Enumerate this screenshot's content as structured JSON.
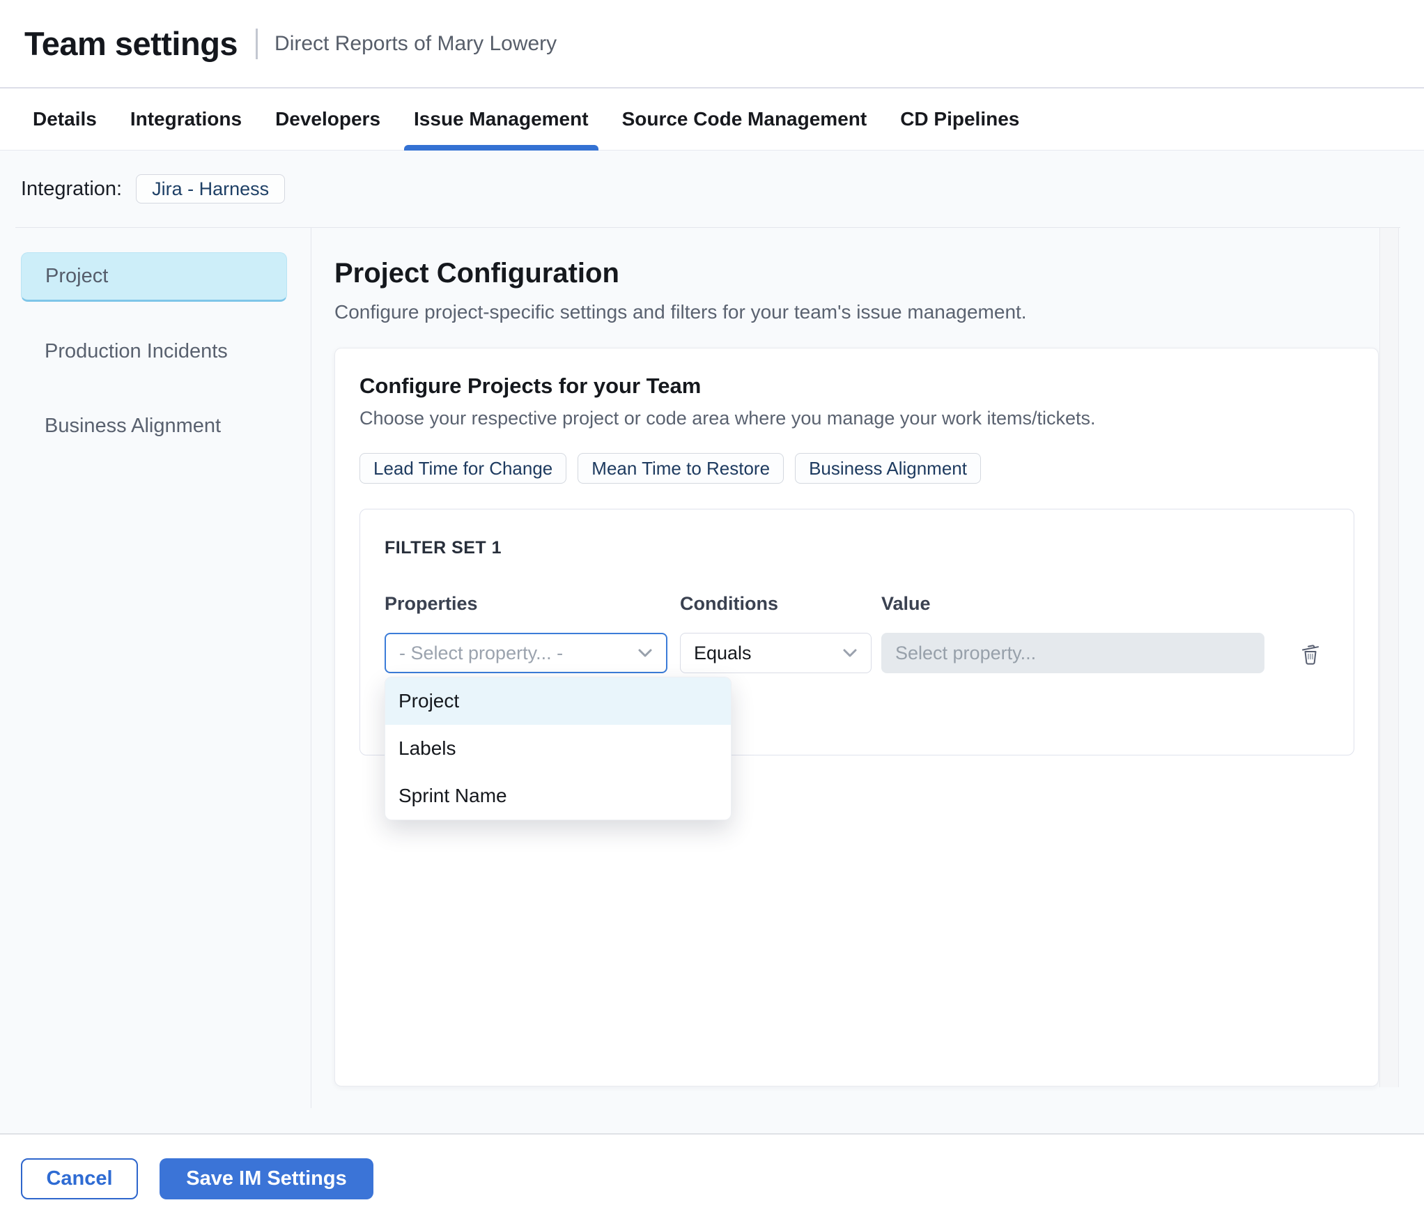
{
  "header": {
    "title": "Team settings",
    "subtitle": "Direct Reports of Mary Lowery"
  },
  "tabs": [
    {
      "label": "Details",
      "active": false
    },
    {
      "label": "Integrations",
      "active": false
    },
    {
      "label": "Developers",
      "active": false
    },
    {
      "label": "Issue Management",
      "active": true
    },
    {
      "label": "Source Code Management",
      "active": false
    },
    {
      "label": "CD Pipelines",
      "active": false
    }
  ],
  "integration": {
    "label": "Integration:",
    "value": "Jira - Harness"
  },
  "sidebar": {
    "items": [
      {
        "label": "Project",
        "active": true
      },
      {
        "label": "Production Incidents",
        "active": false
      },
      {
        "label": "Business Alignment",
        "active": false
      }
    ]
  },
  "main": {
    "title": "Project Configuration",
    "description": "Configure project-specific settings and filters for your team's issue management.",
    "card": {
      "title": "Configure Projects for your Team",
      "subtitle": "Choose your respective project or code area where you manage your work items/tickets.",
      "metric_chips": [
        {
          "label": "Lead Time for Change"
        },
        {
          "label": "Mean Time to Restore"
        },
        {
          "label": "Business Alignment"
        }
      ],
      "filter_set": {
        "title": "FILTER SET 1",
        "properties_label": "Properties",
        "conditions_label": "Conditions",
        "value_label": "Value",
        "properties_placeholder": "- Select property... -",
        "conditions_value": "Equals",
        "value_placeholder": "Select property...",
        "dropdown_options": [
          {
            "label": "Project",
            "highlighted": true
          },
          {
            "label": "Labels",
            "highlighted": false
          },
          {
            "label": "Sprint Name",
            "highlighted": false
          }
        ]
      }
    }
  },
  "footer": {
    "cancel_label": "Cancel",
    "save_label": "Save IM Settings"
  },
  "colors": {
    "accent_blue": "#3b74d7",
    "tab_underline": "#3472d3",
    "focus_border": "#3b7cd8",
    "sidebar_active_bg": "#cdeef9",
    "dropdown_highlight": "#e9f5fb",
    "page_bg": "#f8fafc",
    "chip_text": "#1d3a5f"
  }
}
